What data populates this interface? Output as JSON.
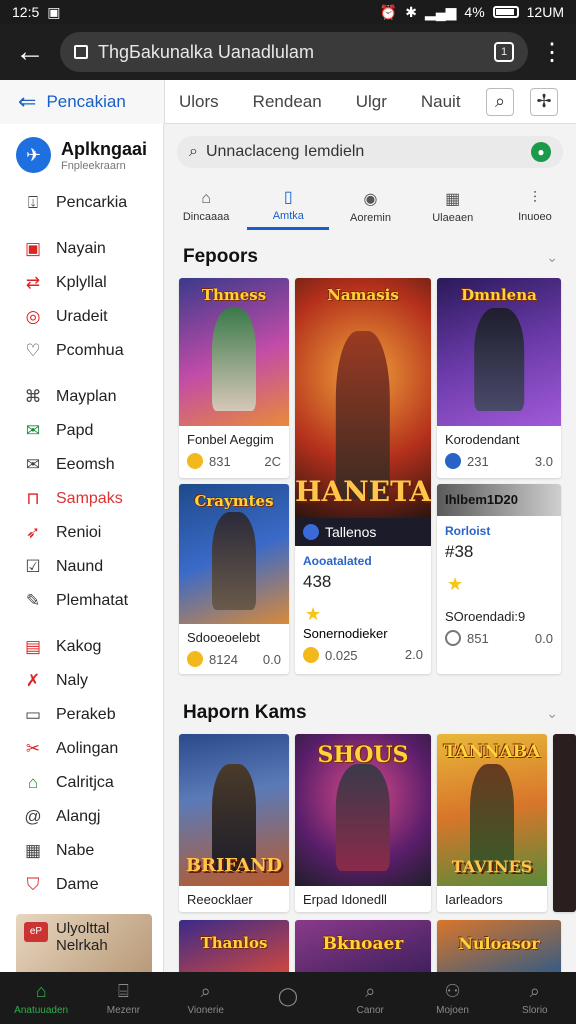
{
  "status": {
    "time": "12:5",
    "battery_text": "4%",
    "right_text": "12UM"
  },
  "browser": {
    "url": "ThgБakunalka Uanadlulam",
    "tab_count": "1"
  },
  "topnav": {
    "home_label": "Pencakian",
    "links": [
      "Ulors",
      "Rendean",
      "Ulgr",
      "Nauit"
    ]
  },
  "sidebar": {
    "brand_title": "Aplkngaai",
    "brand_subtitle": "Fnpleekraarn",
    "items": [
      "Pencarkia",
      "Nayain",
      "Kplyllal",
      "Uradeit",
      "Pcomhua",
      "Mayplan",
      "Papd",
      "Eeomsh",
      "Sampaks",
      "Renioi",
      "Naund",
      "Plemhatat",
      "Kakog",
      "Naly",
      "Perakeb",
      "Aolingan",
      "Calritjca",
      "Alangj",
      "Nabe",
      "Dame"
    ],
    "promo_line1": "Ulyolttal",
    "promo_line2": "Nelrkah",
    "promo_badge": "eP"
  },
  "main": {
    "search_placeholder": "Unnaclaceng Iemdieln",
    "category_tabs": [
      {
        "label": "Dincaaaa",
        "icon": "home-icon"
      },
      {
        "label": "Amtka",
        "icon": "book-icon"
      },
      {
        "label": "Aoremin",
        "icon": "gamepad-icon"
      },
      {
        "label": "Ulaeaen",
        "icon": "grid-icon"
      },
      {
        "label": "Inuoeo",
        "icon": "chart-icon"
      }
    ],
    "section1_title": "Fepoors",
    "section2_title": "Haporn Kams",
    "cards": [
      {
        "art_title": "Thmess",
        "name": "Fonbel Aeggim",
        "coin": "831",
        "rating": "2C",
        "coin_style": "gold"
      },
      {
        "art_title": "Namasis",
        "big_title": "HANETAN",
        "name": "Tallenos",
        "sub": "Aooatalated",
        "price": "438",
        "coin_style": "gold"
      },
      {
        "art_title": "Dmnlena",
        "name": "Korodendant",
        "coin": "231",
        "rating": "3.0",
        "coin_style": "blue"
      },
      {
        "art_title": "Craymtes",
        "name": "Sdooeoelebt",
        "coin": "8124",
        "rating": "0.0",
        "coin_style": "gold"
      },
      {
        "name": "Sonernodieker",
        "coin": "0.025",
        "rating": "2.0",
        "coin_style": "gold"
      },
      {
        "art_title": "Ihlbem1D20",
        "name": "SOroendadi:9",
        "sub": "Rorloist",
        "price": "#38",
        "coin": "851",
        "rating": "0.0",
        "coin_style": "ring"
      }
    ],
    "cards2": [
      {
        "big_title": "BRIFAND",
        "name": "Reeocklaer"
      },
      {
        "art_title": "SHOUS",
        "name": "Erpad Idonedll"
      },
      {
        "art_title": "TANNABA",
        "big_title": "TAVINES",
        "name": "Iarleadors"
      }
    ],
    "cards3": [
      "Thanlos",
      "Bknoaer",
      "Nuloasor"
    ]
  },
  "bottomnav": [
    {
      "label": "Anatuuaden",
      "icon": "home-icon"
    },
    {
      "label": "Mezenr",
      "icon": "library-icon"
    },
    {
      "label": "Vionerie",
      "icon": "search-person-icon"
    },
    {
      "label": "",
      "icon": "circle-icon"
    },
    {
      "label": "Canor",
      "icon": "search-icon"
    },
    {
      "label": "Mojoen",
      "icon": "person-icon"
    },
    {
      "label": "Slorio",
      "icon": "magnify-icon"
    }
  ]
}
